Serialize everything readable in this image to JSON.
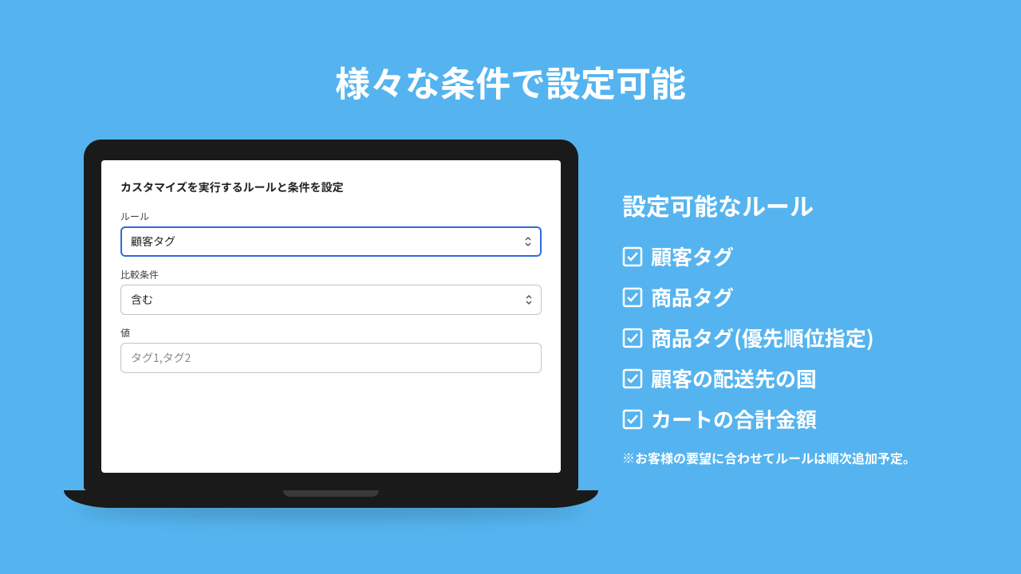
{
  "page": {
    "title": "様々な条件で設定可能"
  },
  "form": {
    "heading": "カスタマイズを実行するルールと条件を設定",
    "rule_label": "ルール",
    "rule_value": "顧客タグ",
    "compare_label": "比較条件",
    "compare_value": "含む",
    "value_label": "値",
    "value_placeholder": "タグ1,タグ2"
  },
  "panel": {
    "heading": "設定可能なルール",
    "items": [
      "顧客タグ",
      "商品タグ",
      "商品タグ(優先順位指定)",
      "顧客の配送先の国",
      "カートの合計金額"
    ],
    "footnote": "※お客様の要望に合わせてルールは順次追加予定。"
  }
}
